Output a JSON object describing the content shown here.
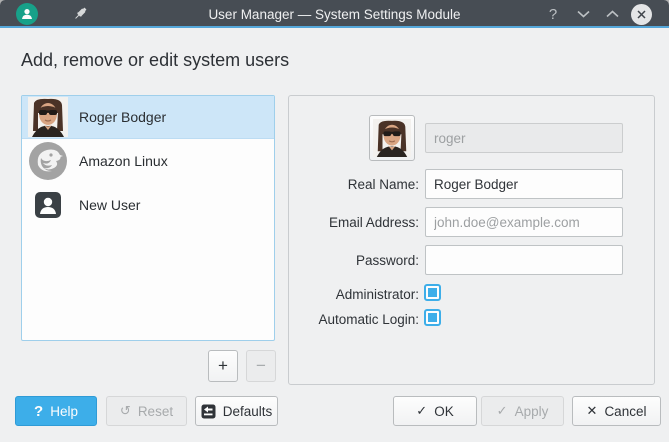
{
  "window": {
    "title": "User Manager — System Settings Module",
    "titlebar_icons": [
      "app-user-icon",
      "pin-icon",
      "help-icon",
      "chevron-down-icon",
      "chevron-up-icon",
      "close-icon"
    ]
  },
  "header": {
    "title": "Add, remove or edit system users"
  },
  "user_list": {
    "items": [
      {
        "name": "Roger Bodger",
        "icon": "roger-avatar",
        "selected": true
      },
      {
        "name": "Amazon Linux",
        "icon": "amazon-linux-logo",
        "selected": false
      },
      {
        "name": "New User",
        "icon": "new-user-icon",
        "selected": false
      }
    ],
    "add_label": "+",
    "remove_label": "−"
  },
  "details": {
    "username": {
      "value": "roger",
      "disabled": true
    },
    "real_name": {
      "label": "Real Name:",
      "value": "Roger Bodger"
    },
    "email": {
      "label": "Email Address:",
      "placeholder": "john.doe@example.com"
    },
    "password": {
      "label": "Password:",
      "value": ""
    },
    "administrator": {
      "label": "Administrator:",
      "checked": true
    },
    "automatic_login": {
      "label": "Automatic Login:",
      "checked": true
    }
  },
  "footer": {
    "help": "Help",
    "reset": "Reset",
    "defaults": "Defaults",
    "ok": "OK",
    "apply": "Apply",
    "cancel": "Cancel",
    "ok_glyph": "✓",
    "apply_glyph": "✓",
    "cancel_glyph": "✕",
    "reset_glyph": "↺"
  },
  "colors": {
    "accent": "#3daee9",
    "titlebar": "#474d54",
    "titlebar_underline": "#54a7da",
    "selection": "#cde6f8",
    "window_bg": "#eff0f1",
    "app_icon_teal": "#17a189"
  }
}
